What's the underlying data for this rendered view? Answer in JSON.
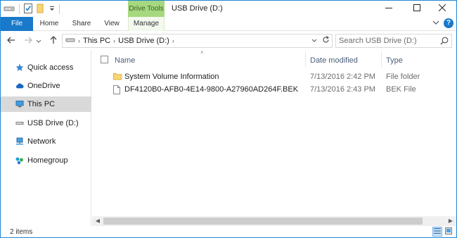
{
  "titlebar": {
    "context_tab": "Drive Tools",
    "title": "USB Drive (D:)",
    "qat_icons": [
      "drive-icon",
      "properties-icon",
      "new-folder-icon",
      "qat-dropdown-icon"
    ],
    "controls": [
      "minimize-icon",
      "maximize-icon",
      "close-icon"
    ]
  },
  "ribbon": {
    "tabs": [
      {
        "label": "File"
      },
      {
        "label": "Home"
      },
      {
        "label": "Share"
      },
      {
        "label": "View"
      },
      {
        "label": "Manage"
      }
    ],
    "expand_icon": "chevron-down-icon",
    "help_label": "?"
  },
  "address": {
    "crumbs": [
      "This PC",
      "USB Drive (D:)"
    ],
    "search_placeholder": "Search USB Drive (D:)"
  },
  "navpane": {
    "items": [
      {
        "label": "Quick access",
        "icon": "star-icon"
      },
      {
        "label": "OneDrive",
        "icon": "cloud-icon"
      },
      {
        "label": "This PC",
        "icon": "computer-icon",
        "selected": true
      },
      {
        "label": "USB Drive (D:)",
        "icon": "usb-drive-icon"
      },
      {
        "label": "Network",
        "icon": "network-icon"
      },
      {
        "label": "Homegroup",
        "icon": "homegroup-icon"
      }
    ]
  },
  "columns": {
    "name": "Name",
    "date": "Date modified",
    "type": "Type"
  },
  "files": [
    {
      "name": "System Volume Information",
      "date": "7/13/2016 2:42 PM",
      "type": "File folder",
      "icon": "folder-icon"
    },
    {
      "name": "DF4120B0-AFB0-4E14-9800-A27960AD264F.BEK",
      "date": "7/13/2016 2:43 PM",
      "type": "BEK File",
      "icon": "file-icon"
    }
  ],
  "status": {
    "item_count": "2 items"
  },
  "colors": {
    "accent": "#1979ca",
    "context_tab": "#a6d87f",
    "selection": "#d9d9d9"
  }
}
